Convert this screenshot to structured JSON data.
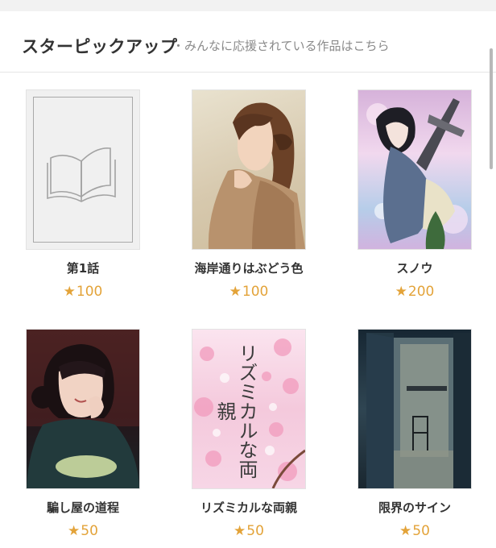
{
  "section": {
    "title": "スターピックアップ",
    "subtitle": "・みんなに応援されている作品はこちら"
  },
  "works": [
    {
      "title": "第1話",
      "star_icon": "★",
      "stars": "100",
      "cover": "placeholder-book-icon"
    },
    {
      "title": "海岸通りはぶどう色",
      "star_icon": "★",
      "stars": "100",
      "cover": "portrait-illustration"
    },
    {
      "title": "スノウ",
      "star_icon": "★",
      "stars": "200",
      "cover": "fantasy-illustration"
    },
    {
      "title": "騙し屋の道程",
      "star_icon": "★",
      "stars": "50",
      "cover": "portrait-illustration"
    },
    {
      "title": "リズミカルな両親",
      "star_icon": "★",
      "stars": "50",
      "cover": "sakura-cover",
      "cover_text": "リズミカルな両親"
    },
    {
      "title": "限界のサイン",
      "star_icon": "★",
      "stars": "50",
      "cover": "door-photo"
    }
  ],
  "colors": {
    "star": "#e3a339",
    "title_text": "#333333",
    "subtitle_text": "#8a8a8a",
    "header_band": "#f2f2f2"
  }
}
